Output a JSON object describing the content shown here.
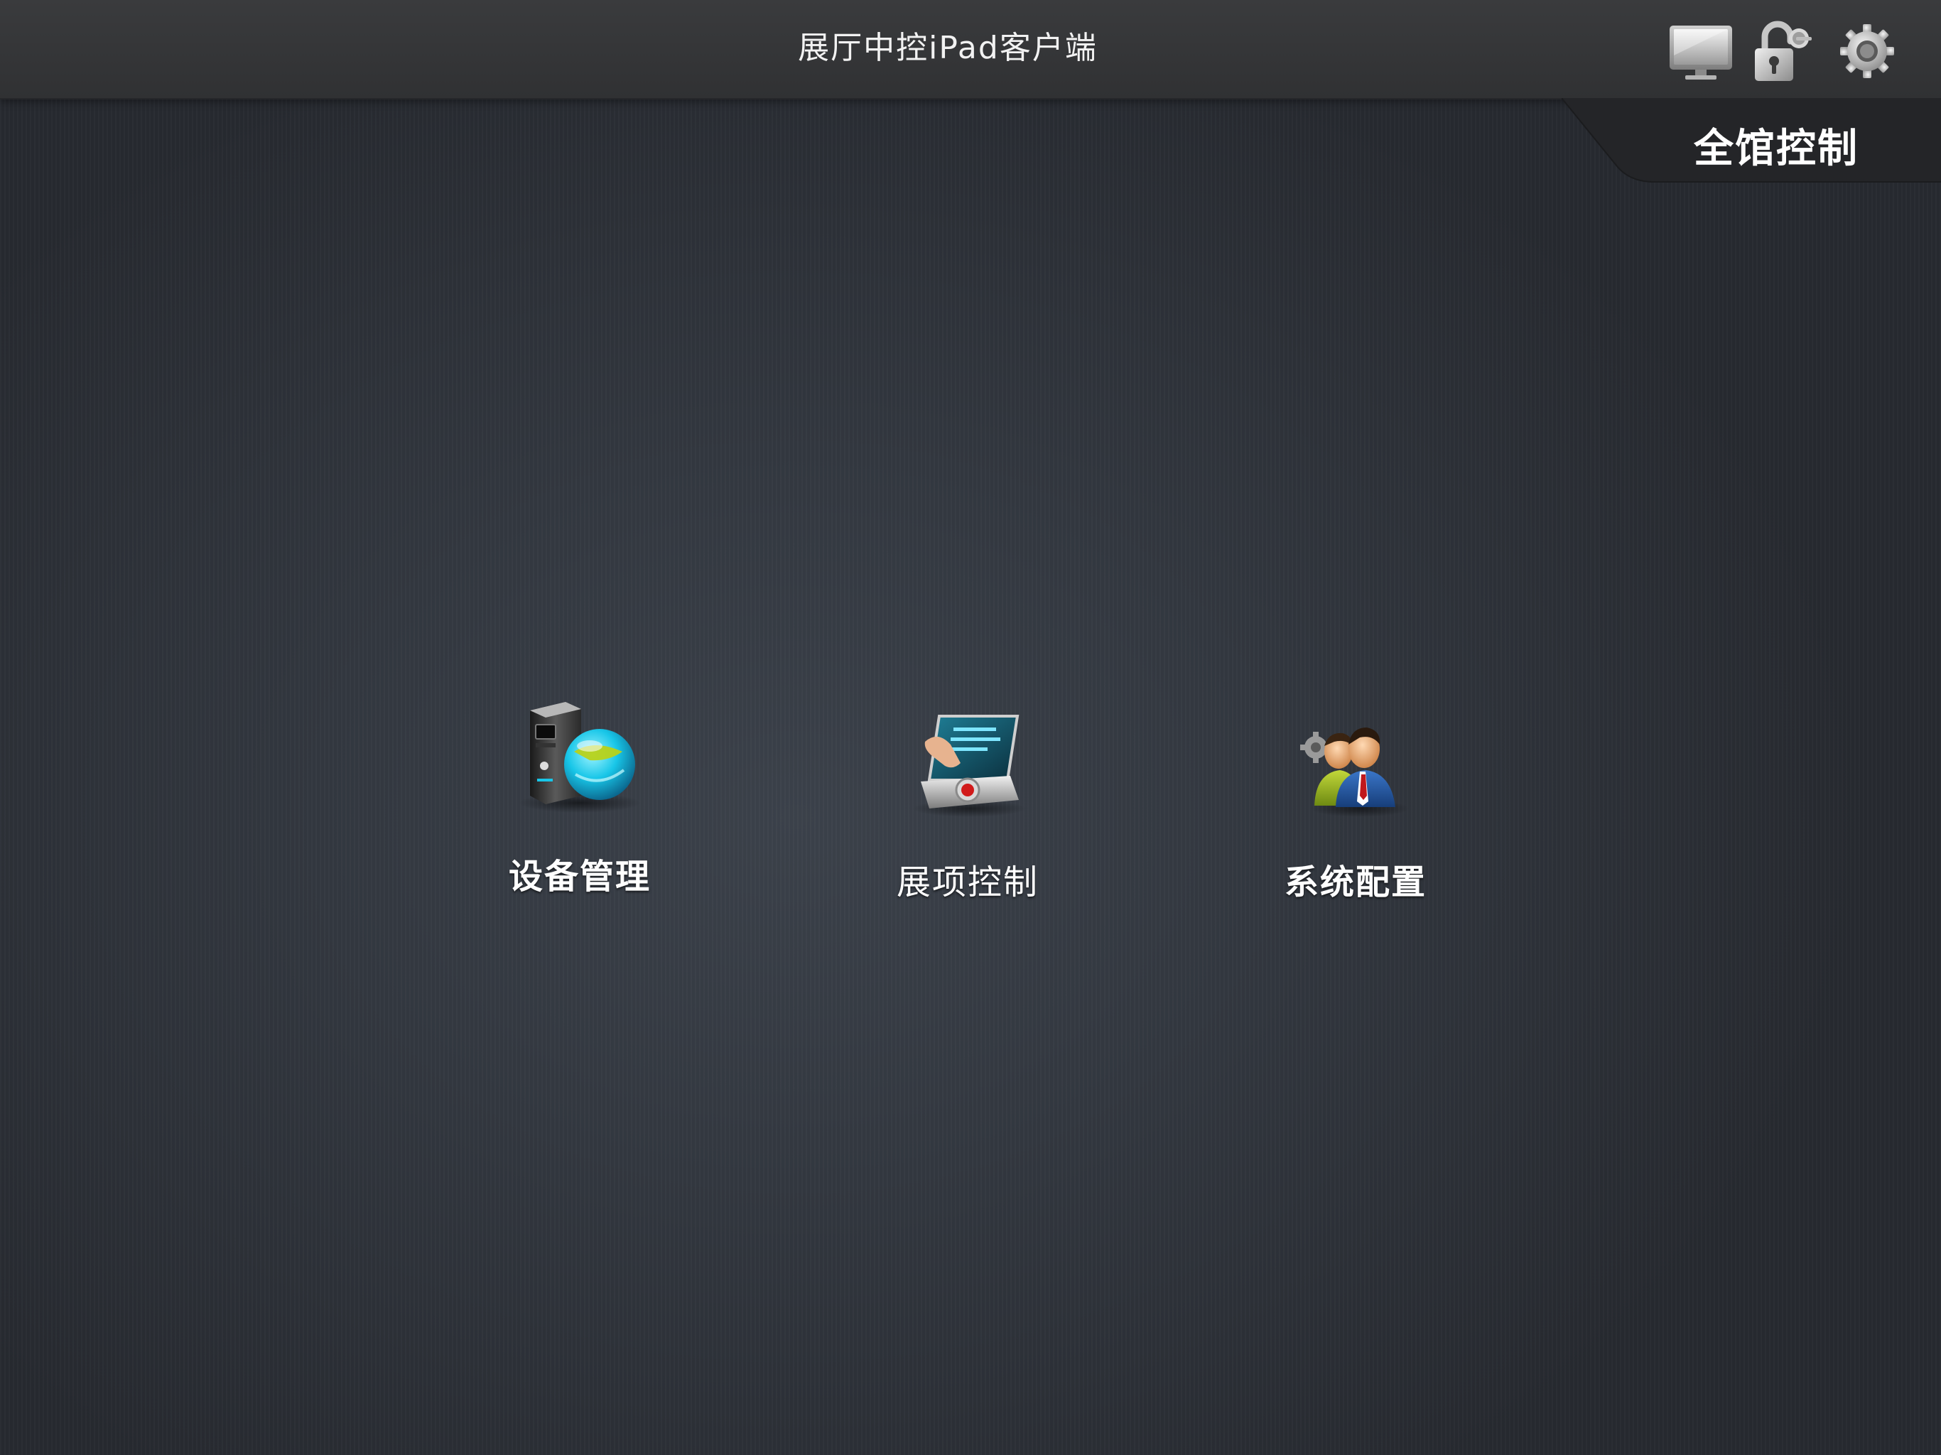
{
  "header": {
    "title": "展厅中控iPad客户端",
    "icons": [
      "monitor-icon",
      "unlock-icon",
      "gear-icon"
    ]
  },
  "tab": {
    "label": "全馆控制"
  },
  "modules": [
    {
      "label": "设备管理",
      "icon": "device-server-globe-icon"
    },
    {
      "label": "展项控制",
      "icon": "touch-panel-icon"
    },
    {
      "label": "系统配置",
      "icon": "users-config-icon"
    }
  ],
  "colors": {
    "background": "#30353d",
    "topbar": "#343537",
    "text": "#ffffff",
    "accent_cyan": "#18c6e8",
    "accent_green": "#b8d21a"
  }
}
